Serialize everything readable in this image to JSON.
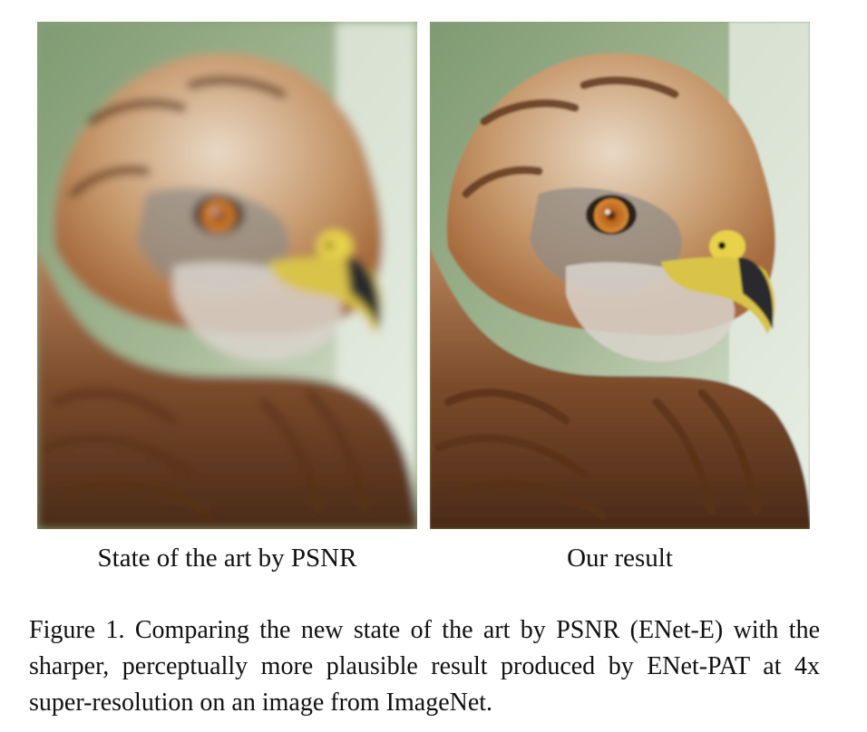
{
  "figure": {
    "panels": [
      {
        "label": "State of the art by PSNR"
      },
      {
        "label": "Our result"
      }
    ],
    "caption": "Figure 1. Comparing the new state of the art by PSNR (ENet-E) with the sharper, perceptually more plausible result produced by ENet-PAT at 4x super-resolution on an image from ImageNet."
  }
}
